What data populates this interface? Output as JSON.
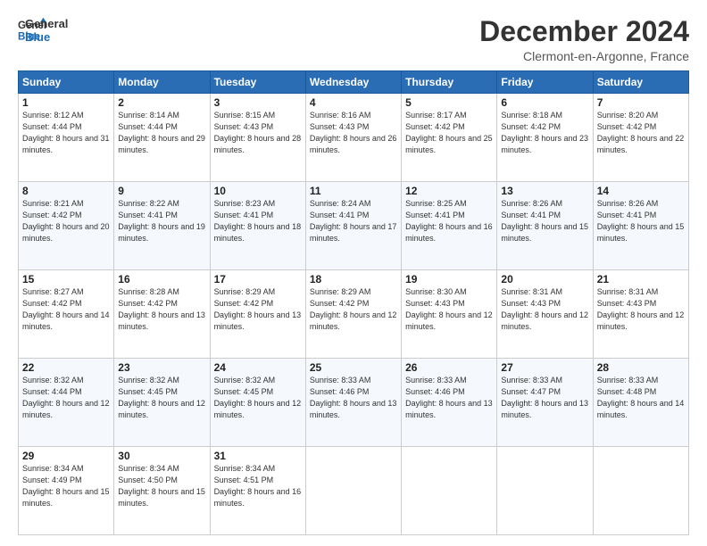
{
  "logo": {
    "line1": "General",
    "line2": "Blue"
  },
  "title": "December 2024",
  "subtitle": "Clermont-en-Argonne, France",
  "days_of_week": [
    "Sunday",
    "Monday",
    "Tuesday",
    "Wednesday",
    "Thursday",
    "Friday",
    "Saturday"
  ],
  "weeks": [
    [
      {
        "day": 1,
        "sunrise": "8:12 AM",
        "sunset": "4:44 PM",
        "daylight": "8 hours and 31 minutes."
      },
      {
        "day": 2,
        "sunrise": "8:14 AM",
        "sunset": "4:44 PM",
        "daylight": "8 hours and 29 minutes."
      },
      {
        "day": 3,
        "sunrise": "8:15 AM",
        "sunset": "4:43 PM",
        "daylight": "8 hours and 28 minutes."
      },
      {
        "day": 4,
        "sunrise": "8:16 AM",
        "sunset": "4:43 PM",
        "daylight": "8 hours and 26 minutes."
      },
      {
        "day": 5,
        "sunrise": "8:17 AM",
        "sunset": "4:42 PM",
        "daylight": "8 hours and 25 minutes."
      },
      {
        "day": 6,
        "sunrise": "8:18 AM",
        "sunset": "4:42 PM",
        "daylight": "8 hours and 23 minutes."
      },
      {
        "day": 7,
        "sunrise": "8:20 AM",
        "sunset": "4:42 PM",
        "daylight": "8 hours and 22 minutes."
      }
    ],
    [
      {
        "day": 8,
        "sunrise": "8:21 AM",
        "sunset": "4:42 PM",
        "daylight": "8 hours and 20 minutes."
      },
      {
        "day": 9,
        "sunrise": "8:22 AM",
        "sunset": "4:41 PM",
        "daylight": "8 hours and 19 minutes."
      },
      {
        "day": 10,
        "sunrise": "8:23 AM",
        "sunset": "4:41 PM",
        "daylight": "8 hours and 18 minutes."
      },
      {
        "day": 11,
        "sunrise": "8:24 AM",
        "sunset": "4:41 PM",
        "daylight": "8 hours and 17 minutes."
      },
      {
        "day": 12,
        "sunrise": "8:25 AM",
        "sunset": "4:41 PM",
        "daylight": "8 hours and 16 minutes."
      },
      {
        "day": 13,
        "sunrise": "8:26 AM",
        "sunset": "4:41 PM",
        "daylight": "8 hours and 15 minutes."
      },
      {
        "day": 14,
        "sunrise": "8:26 AM",
        "sunset": "4:41 PM",
        "daylight": "8 hours and 15 minutes."
      }
    ],
    [
      {
        "day": 15,
        "sunrise": "8:27 AM",
        "sunset": "4:42 PM",
        "daylight": "8 hours and 14 minutes."
      },
      {
        "day": 16,
        "sunrise": "8:28 AM",
        "sunset": "4:42 PM",
        "daylight": "8 hours and 13 minutes."
      },
      {
        "day": 17,
        "sunrise": "8:29 AM",
        "sunset": "4:42 PM",
        "daylight": "8 hours and 13 minutes."
      },
      {
        "day": 18,
        "sunrise": "8:29 AM",
        "sunset": "4:42 PM",
        "daylight": "8 hours and 12 minutes."
      },
      {
        "day": 19,
        "sunrise": "8:30 AM",
        "sunset": "4:43 PM",
        "daylight": "8 hours and 12 minutes."
      },
      {
        "day": 20,
        "sunrise": "8:31 AM",
        "sunset": "4:43 PM",
        "daylight": "8 hours and 12 minutes."
      },
      {
        "day": 21,
        "sunrise": "8:31 AM",
        "sunset": "4:43 PM",
        "daylight": "8 hours and 12 minutes."
      }
    ],
    [
      {
        "day": 22,
        "sunrise": "8:32 AM",
        "sunset": "4:44 PM",
        "daylight": "8 hours and 12 minutes."
      },
      {
        "day": 23,
        "sunrise": "8:32 AM",
        "sunset": "4:45 PM",
        "daylight": "8 hours and 12 minutes."
      },
      {
        "day": 24,
        "sunrise": "8:32 AM",
        "sunset": "4:45 PM",
        "daylight": "8 hours and 12 minutes."
      },
      {
        "day": 25,
        "sunrise": "8:33 AM",
        "sunset": "4:46 PM",
        "daylight": "8 hours and 13 minutes."
      },
      {
        "day": 26,
        "sunrise": "8:33 AM",
        "sunset": "4:46 PM",
        "daylight": "8 hours and 13 minutes."
      },
      {
        "day": 27,
        "sunrise": "8:33 AM",
        "sunset": "4:47 PM",
        "daylight": "8 hours and 13 minutes."
      },
      {
        "day": 28,
        "sunrise": "8:33 AM",
        "sunset": "4:48 PM",
        "daylight": "8 hours and 14 minutes."
      }
    ],
    [
      {
        "day": 29,
        "sunrise": "8:34 AM",
        "sunset": "4:49 PM",
        "daylight": "8 hours and 15 minutes."
      },
      {
        "day": 30,
        "sunrise": "8:34 AM",
        "sunset": "4:50 PM",
        "daylight": "8 hours and 15 minutes."
      },
      {
        "day": 31,
        "sunrise": "8:34 AM",
        "sunset": "4:51 PM",
        "daylight": "8 hours and 16 minutes."
      },
      null,
      null,
      null,
      null
    ]
  ]
}
